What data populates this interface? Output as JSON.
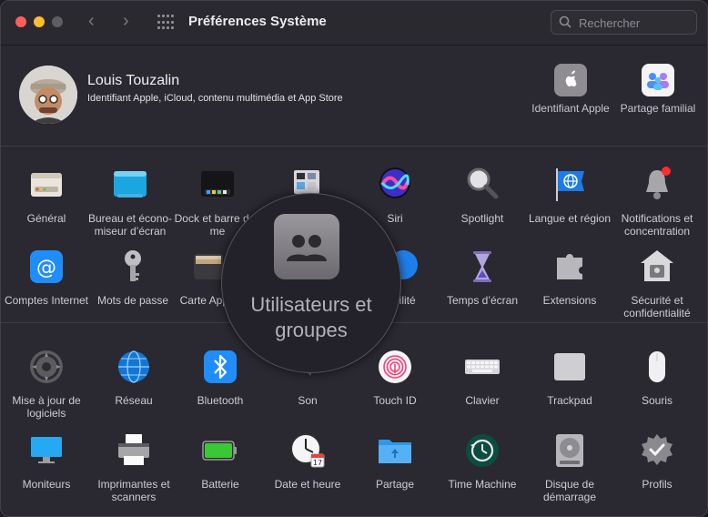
{
  "window": {
    "title": "Préférences Système",
    "search_placeholder": "Rechercher"
  },
  "user": {
    "name": "Louis Touzalin",
    "subtitle": "Identifiant Apple, iCloud, contenu multimédia et App Store"
  },
  "top_items": [
    {
      "label": "Identifiant Apple",
      "icon": "apple-id-icon"
    },
    {
      "label": "Partage familial",
      "icon": "family-sharing-icon"
    }
  ],
  "row1": [
    {
      "label": "Général",
      "icon": "general-icon"
    },
    {
      "label": "Bureau et écono-miseur d’écran",
      "icon": "desktop-icon"
    },
    {
      "label": "Dock et barre des me",
      "icon": "dock-icon"
    },
    {
      "label": "",
      "icon": "mission-control-icon"
    },
    {
      "label": "Siri",
      "icon": "siri-icon"
    },
    {
      "label": "Spotlight",
      "icon": "spotlight-icon"
    },
    {
      "label": "Langue et région",
      "icon": "language-region-icon"
    },
    {
      "label": "Notifications et concentration",
      "icon": "notifications-icon"
    }
  ],
  "row2": [
    {
      "label": "Comptes Internet",
      "icon": "internet-accounts-icon"
    },
    {
      "label": "Mots de passe",
      "icon": "passwords-icon"
    },
    {
      "label": "Carte Apple",
      "icon": "wallet-icon"
    },
    {
      "label": "ibilité",
      "icon": "accessibility-icon"
    },
    {
      "label": "Temps d’écran",
      "icon": "screen-time-icon"
    },
    {
      "label": "Extensions",
      "icon": "extensions-icon"
    },
    {
      "label": "Sécurité et confidentialité",
      "icon": "security-icon"
    }
  ],
  "row3": [
    {
      "label": "Mise à jour de logiciels",
      "icon": "software-update-icon"
    },
    {
      "label": "Réseau",
      "icon": "network-icon"
    },
    {
      "label": "Bluetooth",
      "icon": "bluetooth-icon"
    },
    {
      "label": "Son",
      "icon": "sound-icon"
    },
    {
      "label": "Touch ID",
      "icon": "touch-id-icon"
    },
    {
      "label": "Clavier",
      "icon": "keyboard-icon"
    },
    {
      "label": "Trackpad",
      "icon": "trackpad-icon"
    },
    {
      "label": "Souris",
      "icon": "mouse-icon"
    }
  ],
  "row4": [
    {
      "label": "Moniteurs",
      "icon": "displays-icon"
    },
    {
      "label": "Imprimantes et scanners",
      "icon": "printers-icon"
    },
    {
      "label": "Batterie",
      "icon": "battery-icon"
    },
    {
      "label": "Date et heure",
      "icon": "date-time-icon"
    },
    {
      "label": "Partage",
      "icon": "sharing-icon"
    },
    {
      "label": "Time Machine",
      "icon": "time-machine-icon"
    },
    {
      "label": "Disque de démarrage",
      "icon": "startup-disk-icon"
    },
    {
      "label": "Profils",
      "icon": "profiles-icon"
    }
  ],
  "magnifier": {
    "label": "Utilisateurs et groupes",
    "icon": "users-groups-icon"
  },
  "colors": {
    "close": "#fe5f57",
    "minimize": "#febc2e",
    "zoom": "#5f5d63",
    "window_bg": "#2a2830",
    "accent_blue": "#1f8dfb"
  }
}
